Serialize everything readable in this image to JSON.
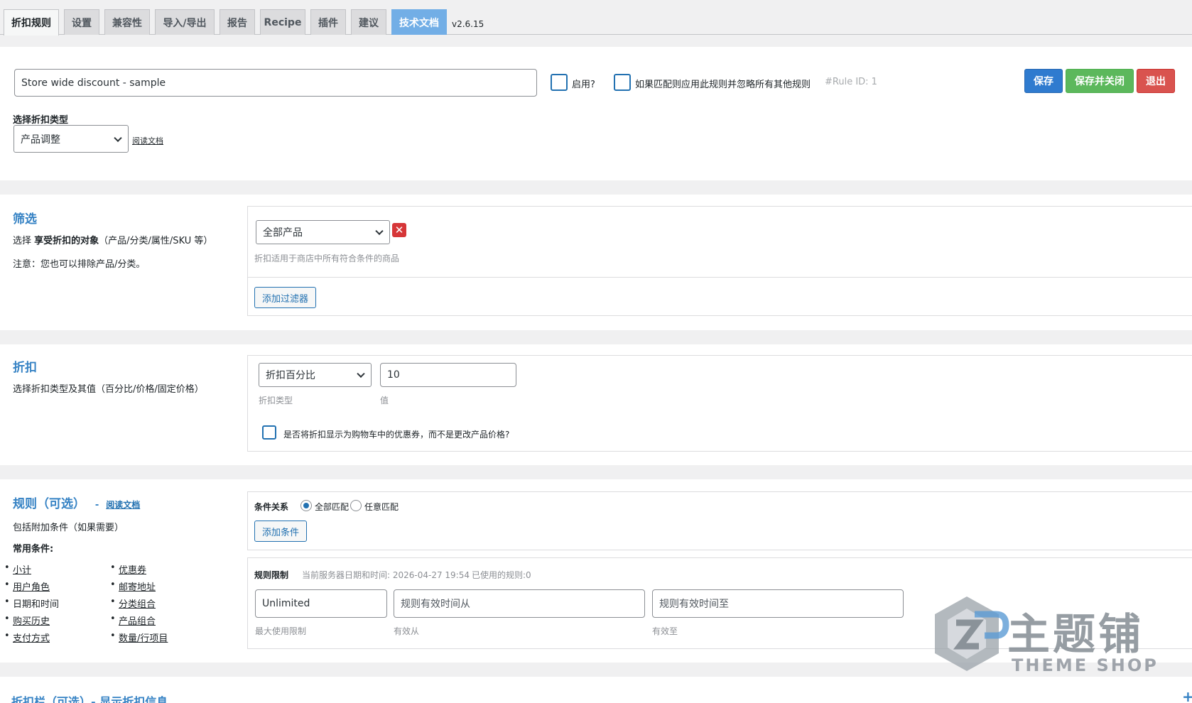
{
  "tabs": [
    {
      "label": "折扣规则"
    },
    {
      "label": "设置"
    },
    {
      "label": "兼容性"
    },
    {
      "label": "导入/导出"
    },
    {
      "label": "报告"
    },
    {
      "label": "Recipe"
    },
    {
      "label": "插件"
    },
    {
      "label": "建议"
    },
    {
      "label": "技术文档"
    }
  ],
  "version": "v2.6.15",
  "header": {
    "rule_title_value": "Store wide discount - sample",
    "enable_label": "启用?",
    "exclusive_label": "如果匹配则应用此规则并忽略所有其他规则",
    "rule_id": "#Rule ID: 1",
    "save_label": "保存",
    "save_close_label": "保存并关闭",
    "exit_label": "退出",
    "discount_type_heading": "选择折扣类型",
    "discount_type_value": "产品调整",
    "read_docs": "阅读文档"
  },
  "filter": {
    "title": "筛选",
    "desc_prefix": "选择",
    "desc_bold": "享受折扣的对象",
    "desc_suffix": "（产品/分类/属性/SKU 等）",
    "note": "注意：您也可以排除产品/分类。",
    "select_value": "全部产品",
    "remove_icon": "✕",
    "hint": "折扣适用于商店中所有符合条件的商品",
    "add_filter": "添加过滤器"
  },
  "discount": {
    "title": "折扣",
    "desc": "选择折扣类型及其值（百分比/价格/固定价格）",
    "type_value": "折扣百分比",
    "amount_value": "10",
    "type_label": "折扣类型",
    "value_label": "值",
    "coupon_label": "是否将折扣显示为购物车中的优惠券，而不是更改产品价格?"
  },
  "rules": {
    "title": "规则（可选）",
    "dash": "-",
    "read_docs": "阅读文档",
    "desc": "包括附加条件（如果需要）",
    "common_heading": "常用条件:",
    "conditions_left": [
      "小计",
      "用户角色",
      "日期和时间",
      "购买历史",
      "支付方式"
    ],
    "conditions_right": [
      "优惠券",
      "邮寄地址",
      "分类组合",
      "产品组合",
      "数量/行项目"
    ],
    "relation_label": "条件关系",
    "match_all": "全部匹配",
    "match_any": "任意匹配",
    "add_condition": "添加条件",
    "limits_label": "规则限制",
    "server_time": "当前服务器日期和时间: 2026-04-27 19:54",
    "used_count": "已使用的规则:0",
    "max_usage_value": "Unlimited",
    "valid_from_placeholder": "规则有效时间从",
    "valid_to_placeholder": "规则有效时间至",
    "max_usage_label": "最大使用限制",
    "valid_from_label": "有效从",
    "valid_to_label": "有效至"
  },
  "bottom": {
    "partial_title": "折扣栏（可选）- 显示折扣信息",
    "plus": "+"
  },
  "watermark": {
    "brand_cn": "主题铺",
    "brand_en": "THEME SHOP"
  }
}
